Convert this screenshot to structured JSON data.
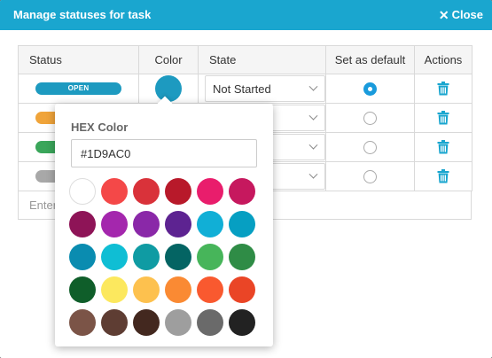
{
  "header": {
    "title": "Manage statuses for task",
    "close_label": "Close"
  },
  "table": {
    "columns": [
      "Status",
      "Color",
      "State",
      "Set as default",
      "Actions"
    ],
    "rows": [
      {
        "status": "OPEN",
        "color": "#1D9AC0",
        "state": "Not Started",
        "default": true
      },
      {
        "status": "",
        "color": "#f0a43a",
        "state": "",
        "default": false
      },
      {
        "status": "",
        "color": "#3aa65a",
        "state": "",
        "default": false
      },
      {
        "status": "",
        "color": "#a8a8a8",
        "state": "",
        "default": false
      }
    ],
    "new_status_placeholder": "Enter"
  },
  "color_picker": {
    "label": "HEX Color",
    "hex_value": "#1D9AC0",
    "swatches": [
      "#ffffff",
      "#f44848",
      "#d9323a",
      "#b8192a",
      "#e91d6c",
      "#c6185e",
      "#8e1457",
      "#a427ad",
      "#8a28a8",
      "#5d2391",
      "#11afd6",
      "#069fc2",
      "#0a8cb0",
      "#0fbed4",
      "#0f9ba3",
      "#046463",
      "#47b55a",
      "#2f8c46",
      "#0f5e2a",
      "#fce85e",
      "#fdc14e",
      "#fa8a33",
      "#f9592f",
      "#ea4526",
      "#7b5447",
      "#5e3d33",
      "#43281f",
      "#9e9e9e",
      "#6a6a6a",
      "#222222"
    ]
  },
  "icons": {
    "close": "close-icon",
    "trash": "trash-icon",
    "chevron": "chevron-down-icon"
  }
}
